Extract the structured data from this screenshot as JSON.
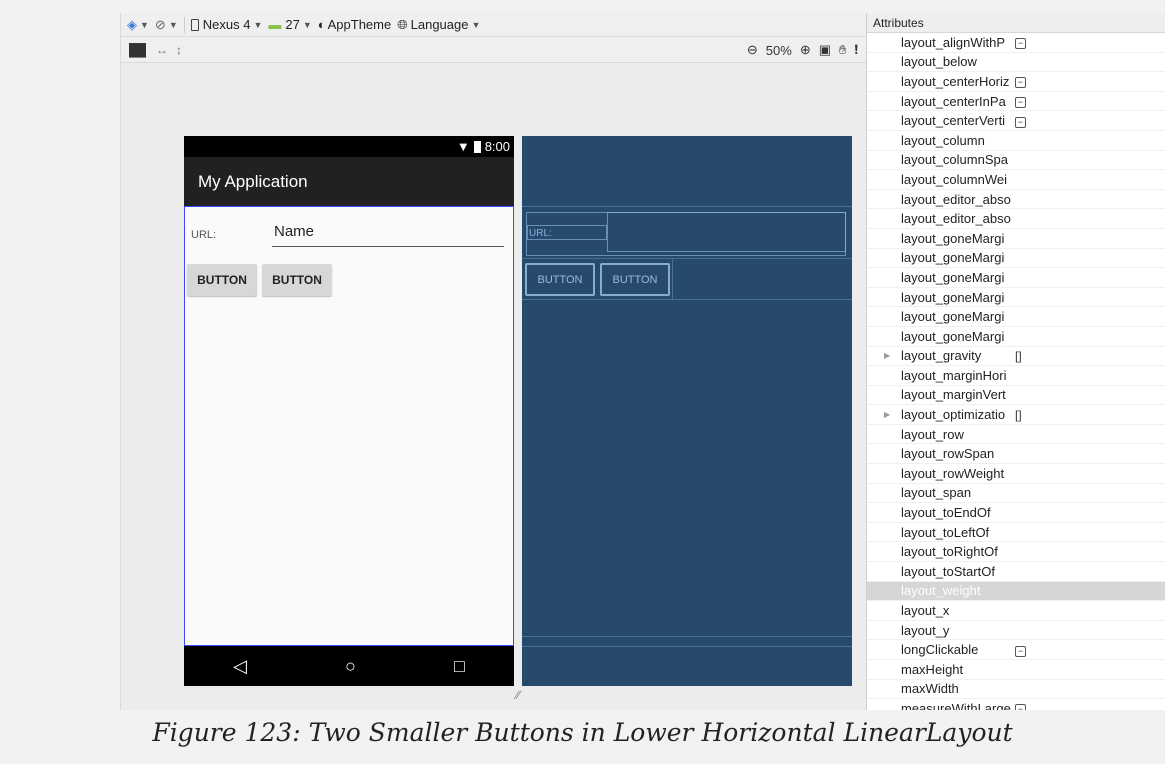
{
  "toolbar": {
    "device": "Nexus 4",
    "api_level": "27",
    "theme": "AppTheme",
    "language": "Language",
    "zoom": "50%"
  },
  "phone": {
    "status_time": "8:00",
    "app_title": "My Application",
    "url_label": "URL:",
    "name_field": "Name",
    "button1": "BUTTON",
    "button2": "BUTTON"
  },
  "blueprint": {
    "url_label": "URL:",
    "button1": "BUTTON",
    "button2": "BUTTON"
  },
  "attributes": {
    "header": "Attributes",
    "items": [
      {
        "name": "layout_alignWithP",
        "value": "",
        "box": true,
        "arrow": false
      },
      {
        "name": "layout_below",
        "value": "",
        "box": false,
        "arrow": false
      },
      {
        "name": "layout_centerHoriz",
        "value": "",
        "box": true,
        "arrow": false
      },
      {
        "name": "layout_centerInPa",
        "value": "",
        "box": true,
        "arrow": false
      },
      {
        "name": "layout_centerVerti",
        "value": "",
        "box": true,
        "arrow": false
      },
      {
        "name": "layout_column",
        "value": "",
        "box": false,
        "arrow": false
      },
      {
        "name": "layout_columnSpa",
        "value": "",
        "box": false,
        "arrow": false
      },
      {
        "name": "layout_columnWei",
        "value": "",
        "box": false,
        "arrow": false
      },
      {
        "name": "layout_editor_abso",
        "value": "",
        "box": false,
        "arrow": false
      },
      {
        "name": "layout_editor_abso",
        "value": "",
        "box": false,
        "arrow": false
      },
      {
        "name": "layout_goneMargi",
        "value": "",
        "box": false,
        "arrow": false
      },
      {
        "name": "layout_goneMargi",
        "value": "",
        "box": false,
        "arrow": false
      },
      {
        "name": "layout_goneMargi",
        "value": "",
        "box": false,
        "arrow": false
      },
      {
        "name": "layout_goneMargi",
        "value": "",
        "box": false,
        "arrow": false
      },
      {
        "name": "layout_goneMargi",
        "value": "",
        "box": false,
        "arrow": false
      },
      {
        "name": "layout_goneMargi",
        "value": "",
        "box": false,
        "arrow": false
      },
      {
        "name": "layout_gravity",
        "value": "[]",
        "box": false,
        "arrow": true
      },
      {
        "name": "layout_marginHori",
        "value": "",
        "box": false,
        "arrow": false
      },
      {
        "name": "layout_marginVert",
        "value": "",
        "box": false,
        "arrow": false
      },
      {
        "name": "layout_optimizatio",
        "value": "[]",
        "box": false,
        "arrow": true
      },
      {
        "name": "layout_row",
        "value": "",
        "box": false,
        "arrow": false
      },
      {
        "name": "layout_rowSpan",
        "value": "",
        "box": false,
        "arrow": false
      },
      {
        "name": "layout_rowWeight",
        "value": "",
        "box": false,
        "arrow": false
      },
      {
        "name": "layout_span",
        "value": "",
        "box": false,
        "arrow": false
      },
      {
        "name": "layout_toEndOf",
        "value": "",
        "box": false,
        "arrow": false
      },
      {
        "name": "layout_toLeftOf",
        "value": "",
        "box": false,
        "arrow": false
      },
      {
        "name": "layout_toRightOf",
        "value": "",
        "box": false,
        "arrow": false
      },
      {
        "name": "layout_toStartOf",
        "value": "",
        "box": false,
        "arrow": false
      },
      {
        "name": "layout_weight",
        "value": "",
        "box": false,
        "arrow": false,
        "selected": true
      },
      {
        "name": "layout_x",
        "value": "",
        "box": false,
        "arrow": false
      },
      {
        "name": "layout_y",
        "value": "",
        "box": false,
        "arrow": false
      },
      {
        "name": "longClickable",
        "value": "",
        "box": true,
        "arrow": false
      },
      {
        "name": "maxHeight",
        "value": "",
        "box": false,
        "arrow": false
      },
      {
        "name": "maxWidth",
        "value": "",
        "box": false,
        "arrow": false
      },
      {
        "name": "measureWithLarge",
        "value": "",
        "box": true,
        "arrow": false
      }
    ]
  },
  "caption": "Figure 123: Two Smaller Buttons in Lower Horizontal LinearLayout"
}
